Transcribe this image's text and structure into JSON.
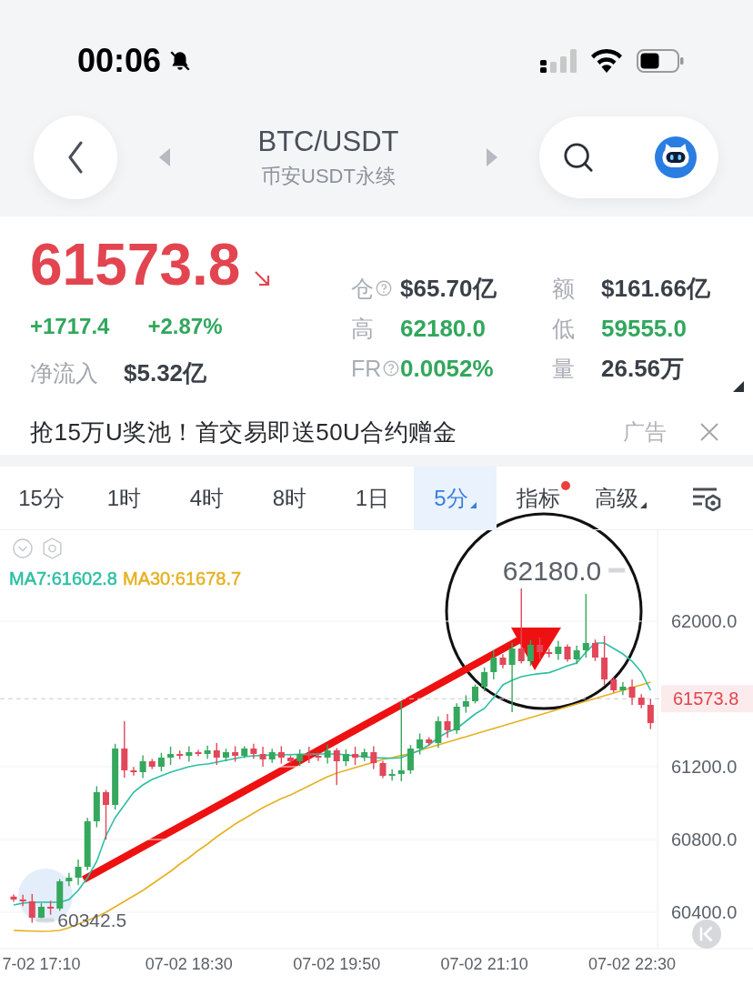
{
  "status_bar": {
    "time": "00:06"
  },
  "header": {
    "title": "BTC/USDT",
    "subtitle": "币安USDT永续"
  },
  "ticker": {
    "price": "61573.8",
    "falling": true,
    "change": "+1717.4",
    "change_percent": "+2.87%",
    "net_inflow_label": "净流入",
    "net_inflow": "$5.32亿"
  },
  "stats": [
    {
      "label": "仓",
      "kind": "help",
      "value": "$65.70亿",
      "color": "#3a3f47"
    },
    {
      "label": "额",
      "kind": "plain",
      "value": "$161.66亿",
      "color": "#3a3f47"
    },
    {
      "label": "高",
      "kind": "plain",
      "value": "62180.0",
      "color": "#31a75c"
    },
    {
      "label": "低",
      "kind": "plain",
      "value": "59555.0",
      "color": "#31a75c"
    },
    {
      "label": "FR",
      "kind": "help",
      "value": "0.0052%",
      "color": "#31a75c"
    },
    {
      "label": "量",
      "kind": "plain",
      "value": "26.56万",
      "color": "#3a3f47"
    }
  ],
  "ad": {
    "text": "抢15万U奖池！首交易即送50U合约赠金",
    "tag": "广告"
  },
  "intervals": [
    {
      "label": "15分",
      "selected": false,
      "dropdown": false,
      "badge": false
    },
    {
      "label": "1时",
      "selected": false,
      "dropdown": false,
      "badge": false
    },
    {
      "label": "4时",
      "selected": false,
      "dropdown": false,
      "badge": false
    },
    {
      "label": "8时",
      "selected": false,
      "dropdown": false,
      "badge": false
    },
    {
      "label": "1日",
      "selected": false,
      "dropdown": false,
      "badge": false
    },
    {
      "label": "5分",
      "selected": true,
      "dropdown": true,
      "badge": false
    },
    {
      "label": "指标",
      "selected": false,
      "dropdown": false,
      "badge": true
    },
    {
      "label": "高级",
      "selected": false,
      "dropdown": true,
      "badge": false
    }
  ],
  "chart": {
    "high_label": "62180.0",
    "low_label": "60342.5",
    "chart_data": {
      "type": "candlestick",
      "grid": true,
      "ylim": [
        60200,
        62500
      ],
      "yticks": [
        {
          "value": 62000,
          "label": "62000.0"
        },
        {
          "value": 61200,
          "label": "61200.0"
        },
        {
          "value": 60800,
          "label": "60800.0"
        },
        {
          "value": 60400,
          "label": "60400.0"
        }
      ],
      "categories": [
        null,
        null,
        null,
        "7-02 17:10",
        null,
        null,
        null,
        null,
        null,
        null,
        null,
        null,
        null,
        null,
        null,
        null,
        null,
        null,
        null,
        "07-02 18:30",
        null,
        null,
        null,
        null,
        null,
        null,
        null,
        null,
        null,
        null,
        null,
        null,
        null,
        null,
        null,
        "07-02 19:50",
        null,
        null,
        null,
        null,
        null,
        null,
        null,
        null,
        null,
        null,
        null,
        null,
        null,
        null,
        null,
        "07-02 21:10",
        null,
        null,
        null,
        null,
        null,
        null,
        null,
        null,
        null,
        null,
        null,
        null,
        null,
        null,
        null,
        "07-02 22:30",
        null,
        null
      ],
      "ohlc": [
        [
          60486,
          60498,
          60458,
          60470
        ],
        [
          60470,
          60496,
          60434,
          60460
        ],
        [
          60460,
          60500,
          60342.5,
          60370
        ],
        [
          60370,
          60449,
          60351,
          60430
        ],
        [
          60430,
          60463,
          60387,
          60420
        ],
        [
          60420,
          60582,
          60408,
          60570
        ],
        [
          60570,
          60616,
          60544,
          60590
        ],
        [
          60590,
          60690,
          60550,
          60650
        ],
        [
          60650,
          60919,
          60631,
          60900
        ],
        [
          60900,
          61093,
          60867,
          61060
        ],
        [
          61060,
          61072,
          60800,
          60990
        ],
        [
          60990,
          61326,
          60964,
          61300
        ],
        [
          61300,
          61450,
          61140,
          61180
        ],
        [
          61180,
          61199,
          61151,
          61170
        ],
        [
          61170,
          61263,
          61137,
          61230
        ],
        [
          61230,
          61242,
          61188,
          61200
        ],
        [
          61200,
          61276,
          61174,
          61250
        ],
        [
          61250,
          61310,
          61210,
          61270
        ],
        [
          61270,
          61289,
          61241,
          61260
        ],
        [
          61260,
          61313,
          61227,
          61280
        ],
        [
          61280,
          61292,
          61258,
          61270
        ],
        [
          61270,
          61316,
          61244,
          61290
        ],
        [
          61290,
          61330,
          61210,
          61250
        ],
        [
          61250,
          61299,
          61231,
          61280
        ],
        [
          61280,
          61313,
          61227,
          61260
        ],
        [
          61260,
          61312,
          61248,
          61300
        ],
        [
          61300,
          61326,
          61244,
          61270
        ],
        [
          61270,
          61310,
          61200,
          61240
        ],
        [
          61240,
          61299,
          61221,
          61280
        ],
        [
          61280,
          61313,
          61217,
          61250
        ],
        [
          61250,
          61262,
          61218,
          61230
        ],
        [
          61230,
          61296,
          61204,
          61270
        ],
        [
          61270,
          61310,
          61220,
          61260
        ],
        [
          61260,
          61279,
          61231,
          61250
        ],
        [
          61250,
          61323,
          61217,
          61290
        ],
        [
          61290,
          61302,
          61100,
          61230
        ],
        [
          61230,
          61296,
          61204,
          61270
        ],
        [
          61270,
          61310,
          61210,
          61250
        ],
        [
          61250,
          61299,
          61231,
          61280
        ],
        [
          61280,
          61313,
          61187,
          61220
        ],
        [
          61220,
          61232,
          61138,
          61150
        ],
        [
          61150,
          61186,
          61124,
          61160
        ],
        [
          61160,
          61560,
          61120,
          61180
        ],
        [
          61180,
          61319,
          61161,
          61300
        ],
        [
          61300,
          61383,
          61267,
          61350
        ],
        [
          61350,
          61362,
          61318,
          61330
        ],
        [
          61330,
          61476,
          61304,
          61450
        ],
        [
          61450,
          61490,
          61360,
          61400
        ],
        [
          61400,
          61549,
          61381,
          61530
        ],
        [
          61530,
          61593,
          61497,
          61560
        ],
        [
          61560,
          61652,
          61548,
          61640
        ],
        [
          61640,
          61746,
          61614,
          61720
        ],
        [
          61720,
          61840,
          61680,
          61800
        ],
        [
          61800,
          61819,
          61741,
          61760
        ],
        [
          61760,
          61883,
          61500,
          61850
        ],
        [
          61850,
          62180,
          61768,
          61780
        ],
        [
          61780,
          61896,
          61754,
          61870
        ],
        [
          61870,
          61910,
          61790,
          61830
        ],
        [
          61830,
          61849,
          61801,
          61820
        ],
        [
          61820,
          61893,
          61787,
          61860
        ],
        [
          61860,
          61872,
          61778,
          61790
        ],
        [
          61790,
          61866,
          61764,
          61840
        ],
        [
          61840,
          62150,
          61800,
          61880
        ],
        [
          61880,
          61899,
          61781,
          61800
        ],
        [
          61800,
          61920,
          61647,
          61680
        ],
        [
          61680,
          61692,
          61608,
          61620
        ],
        [
          61620,
          61666,
          61594,
          61640
        ],
        [
          61640,
          61680,
          61540,
          61580
        ],
        [
          61580,
          61599,
          61521,
          61540
        ],
        [
          61540,
          61573,
          61407,
          61440
        ]
      ],
      "series": [
        {
          "name": "MA7:61602.8",
          "type": "line",
          "color": "#2cbfa3",
          "values": [
            60440,
            60450,
            60455,
            60455,
            60455,
            60455,
            60470,
            60520,
            60590,
            60680,
            60820,
            60920,
            60990,
            61060,
            61100,
            61130,
            61150,
            61170,
            61185,
            61200,
            61210,
            61215,
            61225,
            61235,
            61245,
            61255,
            61260,
            61262,
            61265,
            61265,
            61266,
            61268,
            61268,
            61270,
            61270,
            61270,
            61265,
            61260,
            61255,
            61250,
            61248,
            61246,
            61250,
            61270,
            61290,
            61320,
            61360,
            61390,
            61410,
            61450,
            61490,
            61520,
            61580,
            61650,
            61675,
            61695,
            61705,
            61712,
            61717,
            61735,
            61755,
            61770,
            61830,
            61880,
            61880,
            61850,
            61820,
            61780,
            61720,
            61620
          ]
        },
        {
          "name": "MA30:61678.7",
          "type": "line",
          "color": "#e6b122",
          "values": [
            60300,
            60298,
            60296,
            60295,
            60296,
            60300,
            60315,
            60335,
            60355,
            60375,
            60400,
            60430,
            60460,
            60490,
            60520,
            60555,
            60590,
            60625,
            60665,
            60700,
            60740,
            60775,
            60815,
            60850,
            60885,
            60915,
            60945,
            60975,
            61000,
            61025,
            61045,
            61070,
            61095,
            61120,
            61145,
            61165,
            61180,
            61195,
            61210,
            61225,
            61240,
            61250,
            61262,
            61272,
            61290,
            61305,
            61320,
            61335,
            61350,
            61365,
            61380,
            61395,
            61410,
            61425,
            61440,
            61455,
            61470,
            61485,
            61500,
            61515,
            61530,
            61545,
            61560,
            61575,
            61590,
            61605,
            61620,
            61635,
            61650,
            61665
          ]
        }
      ],
      "ref_lines": [
        {
          "axis": "y",
          "value": 61573.8,
          "label": "61573.8"
        }
      ]
    }
  }
}
